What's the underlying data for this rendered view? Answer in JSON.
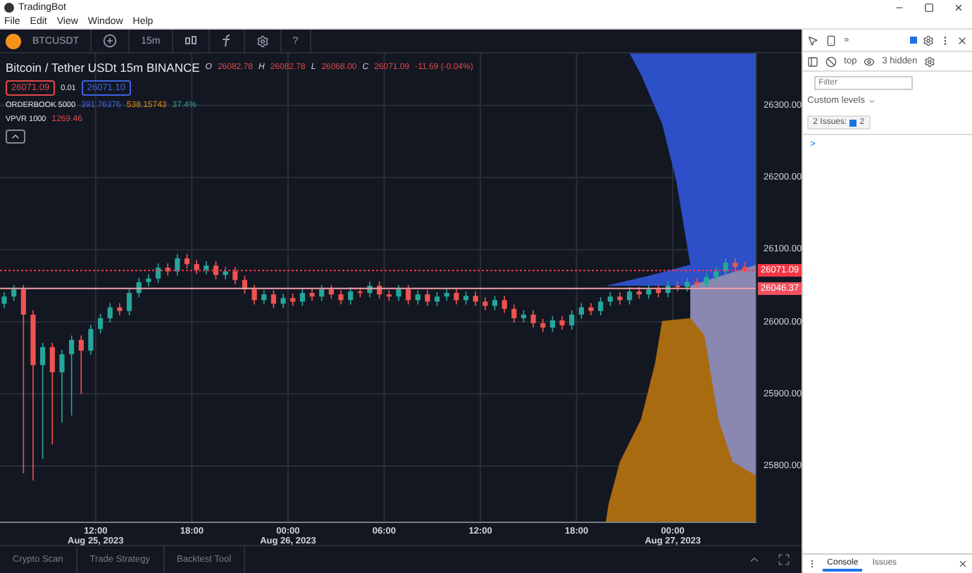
{
  "window": {
    "title": "TradingBot"
  },
  "menu": [
    "File",
    "Edit",
    "View",
    "Window",
    "Help"
  ],
  "toolbar": {
    "symbol": "BTCUSDT",
    "interval": "15m",
    "help": "?"
  },
  "legend": {
    "title": "Bitcoin / Tether USDt 15m BINANCE",
    "ohlc": [
      {
        "key": "O",
        "value": "26082.78"
      },
      {
        "key": "H",
        "value": "26082.78"
      },
      {
        "key": "L",
        "value": "26068.00"
      },
      {
        "key": "C",
        "value": "26071.09"
      }
    ],
    "change": "-11.69 (-0.04%)"
  },
  "order": {
    "sell": "26071.09",
    "size": "0.01",
    "buy": "26071.10"
  },
  "indicators": [
    {
      "name": "ORDERBOOK 5000",
      "values": [
        {
          "text": "391.76376",
          "color": "#3d63e0"
        },
        {
          "text": "538.15743",
          "color": "#d98a1c"
        },
        {
          "text": "37.4%",
          "color": "#22a38f"
        }
      ]
    },
    {
      "name": "VPVR 1000",
      "values": [
        {
          "text": "1269.46",
          "color": "#e04848"
        }
      ]
    }
  ],
  "chart": {
    "chart_data": {
      "type": "candlestick",
      "categories": [
        null,
        null,
        null,
        null,
        null,
        null,
        null,
        null,
        null,
        null,
        null,
        null,
        null,
        null,
        null,
        null,
        null,
        null,
        null,
        null,
        null,
        null,
        null,
        null,
        null,
        null,
        null,
        null,
        null,
        null,
        null,
        null,
        null,
        null,
        null,
        null,
        null,
        null,
        null,
        null,
        null,
        null,
        null,
        null,
        null,
        null,
        null,
        null,
        null,
        null,
        null,
        null,
        null,
        null,
        null,
        null,
        null,
        null,
        null,
        null,
        null,
        null,
        null,
        null,
        null,
        null,
        null,
        null,
        null,
        null,
        null,
        null,
        null,
        null,
        null,
        null,
        null,
        null
      ],
      "ohlc": [
        [
          26025,
          26041,
          26019,
          26035
        ],
        [
          26035,
          26051,
          26029,
          26045
        ],
        [
          26045,
          26051,
          25790,
          26010
        ],
        [
          26010,
          26016,
          25780,
          25940
        ],
        [
          25940,
          25971,
          25810,
          25965
        ],
        [
          25965,
          25971,
          25830,
          25930
        ],
        [
          25930,
          25961,
          25860,
          25955
        ],
        [
          25955,
          25981,
          25870,
          25975
        ],
        [
          25975,
          25981,
          25900,
          25960
        ],
        [
          25960,
          25996,
          25954,
          25990
        ],
        [
          25990,
          26011,
          25984,
          26005
        ],
        [
          26005,
          26026,
          25999,
          26020
        ],
        [
          26020,
          26026,
          26009,
          26015
        ],
        [
          26015,
          26046,
          26009,
          26040
        ],
        [
          26040,
          26061,
          26034,
          26055
        ],
        [
          26055,
          26066,
          26049,
          26060
        ],
        [
          26060,
          26081,
          26054,
          26075
        ],
        [
          26075,
          26081,
          26064,
          26070
        ],
        [
          26070,
          26094,
          26064,
          26088
        ],
        [
          26088,
          26094,
          26074,
          26080
        ],
        [
          26080,
          26086,
          26066,
          26072
        ],
        [
          26072,
          26084,
          26066,
          26078
        ],
        [
          26078,
          26084,
          26059,
          26065
        ],
        [
          26065,
          26076,
          26059,
          26070
        ],
        [
          26070,
          26076,
          26052,
          26058
        ],
        [
          26058,
          26064,
          26039,
          26045
        ],
        [
          26045,
          26051,
          26024,
          26030
        ],
        [
          26030,
          26044,
          26024,
          26038
        ],
        [
          26038,
          26044,
          26019,
          26025
        ],
        [
          26025,
          26039,
          26019,
          26033
        ],
        [
          26033,
          26039,
          26022,
          26028
        ],
        [
          26028,
          26046,
          26022,
          26040
        ],
        [
          26040,
          26046,
          26029,
          26035
        ],
        [
          26035,
          26051,
          26029,
          26045
        ],
        [
          26045,
          26051,
          26032,
          26038
        ],
        [
          26038,
          26044,
          26024,
          26030
        ],
        [
          26030,
          26048,
          26024,
          26042
        ],
        [
          26042,
          26048,
          26034,
          26040
        ],
        [
          26040,
          26056,
          26034,
          26050
        ],
        [
          26050,
          26056,
          26032,
          26038
        ],
        [
          26038,
          26044,
          26029,
          26035
        ],
        [
          26035,
          26051,
          26029,
          26045
        ],
        [
          26045,
          26051,
          26024,
          26030
        ],
        [
          26030,
          26044,
          26024,
          26038
        ],
        [
          26038,
          26044,
          26022,
          26028
        ],
        [
          26028,
          26041,
          26022,
          26035
        ],
        [
          26035,
          26046,
          26029,
          26040
        ],
        [
          26040,
          26046,
          26024,
          26030
        ],
        [
          26030,
          26042,
          26024,
          26036
        ],
        [
          26036,
          26042,
          26022,
          26028
        ],
        [
          26028,
          26034,
          26016,
          26022
        ],
        [
          26022,
          26036,
          26016,
          26030
        ],
        [
          26030,
          26036,
          26012,
          26018
        ],
        [
          26018,
          26024,
          25999,
          26005
        ],
        [
          26005,
          26016,
          25999,
          26010
        ],
        [
          26010,
          26016,
          25992,
          25998
        ],
        [
          25998,
          26004,
          25986,
          25992
        ],
        [
          25992,
          26008,
          25986,
          26002
        ],
        [
          26002,
          26008,
          25989,
          25995
        ],
        [
          25995,
          26016,
          25989,
          26010
        ],
        [
          26010,
          26026,
          26004,
          26020
        ],
        [
          26020,
          26026,
          26009,
          26015
        ],
        [
          26015,
          26034,
          26009,
          26028
        ],
        [
          26028,
          26041,
          26022,
          26035
        ],
        [
          26035,
          26041,
          26024,
          26030
        ],
        [
          26030,
          26048,
          26024,
          26042
        ],
        [
          26042,
          26048,
          26032,
          26038
        ],
        [
          26038,
          26051,
          26032,
          26045
        ],
        [
          26045,
          26051,
          26034,
          26040
        ],
        [
          26040,
          26056,
          26034,
          26050
        ],
        [
          26050,
          26056,
          26042,
          26048
        ],
        [
          26048,
          26061,
          26042,
          26055
        ],
        [
          26055,
          26061,
          26046,
          26052
        ],
        [
          26052,
          26068,
          26046,
          26062
        ],
        [
          26062,
          26076,
          26056,
          26070
        ],
        [
          26070,
          26088,
          26064,
          26082
        ],
        [
          26082,
          26088,
          26070,
          26076
        ],
        [
          26076,
          26083,
          26068,
          26071
        ]
      ],
      "ylim": [
        25722,
        26372
      ],
      "grid": true,
      "ref_lines": [
        {
          "axis": "y",
          "value": 26071.09,
          "label": "26071.09",
          "color": "#f23645"
        },
        {
          "axis": "y",
          "value": 26046.37,
          "label": "26046.37",
          "color": "#f0a0a8"
        }
      ],
      "yticks": [
        {
          "value": 26300,
          "label": "26300.00"
        },
        {
          "value": 26200,
          "label": "26200.00"
        },
        {
          "value": 26100,
          "label": "26100.00"
        },
        {
          "value": 26000,
          "label": "26000.00"
        },
        {
          "value": 25900,
          "label": "25900.00"
        },
        {
          "value": 25800,
          "label": "25800.00"
        }
      ]
    },
    "time_axis": [
      {
        "time": "12:00",
        "date": "Aug 25, 2023"
      },
      {
        "time": "18:00"
      },
      {
        "time": "00:00",
        "date": "Aug 26, 2023"
      },
      {
        "time": "06:00"
      },
      {
        "time": "12:00"
      },
      {
        "time": "18:00"
      },
      {
        "time": "00:00",
        "date": "Aug 27, 2023"
      }
    ]
  },
  "bottom_tabs": [
    "Crypto Scan",
    "Trade Strategy",
    "Backtest Tool"
  ],
  "devtools": {
    "more": "»",
    "context": "top",
    "hidden": "3 hidden",
    "filter_placeholder": "Filter",
    "levels": "Custom levels",
    "issues_label": "2 Issues:",
    "issues_count": "2",
    "prompt": ">",
    "drawer_tabs": [
      {
        "label": "Console",
        "selected": true
      },
      {
        "label": "Issues",
        "selected": false
      }
    ]
  }
}
